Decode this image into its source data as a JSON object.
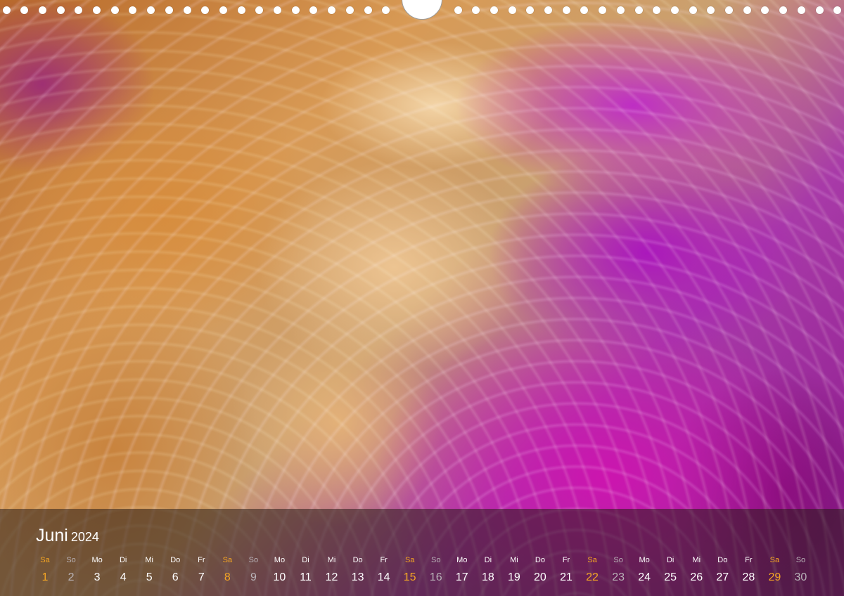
{
  "calendar": {
    "month": "Juni",
    "year": "2024",
    "colors": {
      "weekday": "#ffffff",
      "saturday": "#f5a623",
      "sunday": "#b9b3b8"
    },
    "days": [
      {
        "wd": "Sa",
        "n": "1",
        "t": "sat"
      },
      {
        "wd": "So",
        "n": "2",
        "t": "sun"
      },
      {
        "wd": "Mo",
        "n": "3",
        "t": "wd"
      },
      {
        "wd": "Di",
        "n": "4",
        "t": "wd"
      },
      {
        "wd": "Mi",
        "n": "5",
        "t": "wd"
      },
      {
        "wd": "Do",
        "n": "6",
        "t": "wd"
      },
      {
        "wd": "Fr",
        "n": "7",
        "t": "wd"
      },
      {
        "wd": "Sa",
        "n": "8",
        "t": "sat"
      },
      {
        "wd": "So",
        "n": "9",
        "t": "sun"
      },
      {
        "wd": "Mo",
        "n": "10",
        "t": "wd"
      },
      {
        "wd": "Di",
        "n": "11",
        "t": "wd"
      },
      {
        "wd": "Mi",
        "n": "12",
        "t": "wd"
      },
      {
        "wd": "Do",
        "n": "13",
        "t": "wd"
      },
      {
        "wd": "Fr",
        "n": "14",
        "t": "wd"
      },
      {
        "wd": "Sa",
        "n": "15",
        "t": "sat"
      },
      {
        "wd": "So",
        "n": "16",
        "t": "sun"
      },
      {
        "wd": "Mo",
        "n": "17",
        "t": "wd"
      },
      {
        "wd": "Di",
        "n": "18",
        "t": "wd"
      },
      {
        "wd": "Mi",
        "n": "19",
        "t": "wd"
      },
      {
        "wd": "Do",
        "n": "20",
        "t": "wd"
      },
      {
        "wd": "Fr",
        "n": "21",
        "t": "wd"
      },
      {
        "wd": "Sa",
        "n": "22",
        "t": "sat"
      },
      {
        "wd": "So",
        "n": "23",
        "t": "sun"
      },
      {
        "wd": "Mo",
        "n": "24",
        "t": "wd"
      },
      {
        "wd": "Di",
        "n": "25",
        "t": "wd"
      },
      {
        "wd": "Mi",
        "n": "26",
        "t": "wd"
      },
      {
        "wd": "Do",
        "n": "27",
        "t": "wd"
      },
      {
        "wd": "Fr",
        "n": "28",
        "t": "wd"
      },
      {
        "wd": "Sa",
        "n": "29",
        "t": "sat"
      },
      {
        "wd": "So",
        "n": "30",
        "t": "sun"
      }
    ]
  }
}
